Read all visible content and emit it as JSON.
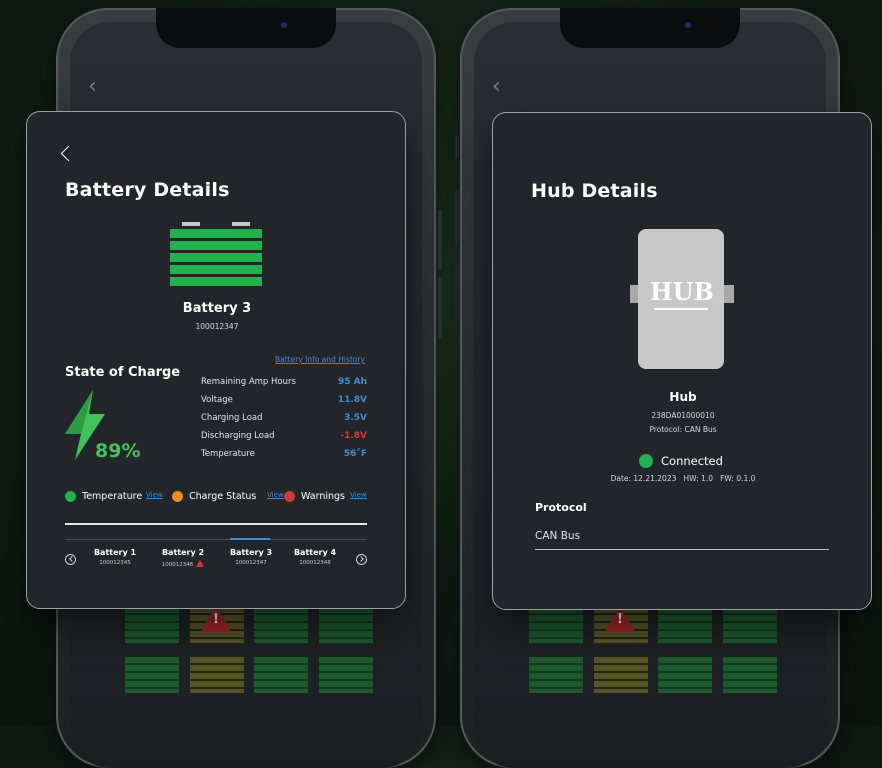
{
  "battery_card": {
    "title": "Battery Details",
    "battery_name": "Battery 3",
    "battery_serial": "100012347",
    "state_of_charge_label": "State of Charge",
    "state_of_charge_value": "89%",
    "info_link": "Battery Info and History",
    "metrics": [
      {
        "label": "Remaining Amp Hours",
        "value": "95 Ah",
        "color": "#3d8dd6"
      },
      {
        "label": "Voltage",
        "value": "11.8V",
        "color": "#3d8dd6"
      },
      {
        "label": "Charging Load",
        "value": "3.5V",
        "color": "#3d8dd6"
      },
      {
        "label": "Discharging Load",
        "value": "-1.8V",
        "color": "#d23a3a"
      },
      {
        "label": "Temperature",
        "value": "56˚F",
        "color": "#3d8dd6"
      }
    ],
    "legend": [
      {
        "label": "Temperature",
        "link": "View",
        "color": "#22b14c"
      },
      {
        "label": "Charge Status",
        "link": "View",
        "color": "#f08a24"
      },
      {
        "label": "Warnings",
        "link": "View",
        "color": "#d23a3a"
      }
    ],
    "tabs": [
      {
        "name": "Battery 1",
        "serial": "100012345",
        "warning": false
      },
      {
        "name": "Battery 2",
        "serial": "100012346",
        "warning": true
      },
      {
        "name": "Battery 3",
        "serial": "100012347",
        "warning": false,
        "active": true
      },
      {
        "name": "Battery 4",
        "serial": "100012348",
        "warning": false
      }
    ]
  },
  "hub_card": {
    "title": "Hub Details",
    "logo_text": "HUB",
    "name": "Hub",
    "serial": "238DA01000010",
    "protocol_line": "Protocol: CAN Bus",
    "status": "Connected",
    "status_color": "#22b14c",
    "version_line": "Date: 12.21.2023   HW: 1.0   FW: 0.1.0",
    "protocol_label": "Protocol",
    "protocol_value": "CAN Bus"
  },
  "colors": {
    "accent": "#3d8dd6",
    "battery_green": "#22b14c",
    "soc_green": "#44c25a",
    "card_bg": "#222529"
  }
}
